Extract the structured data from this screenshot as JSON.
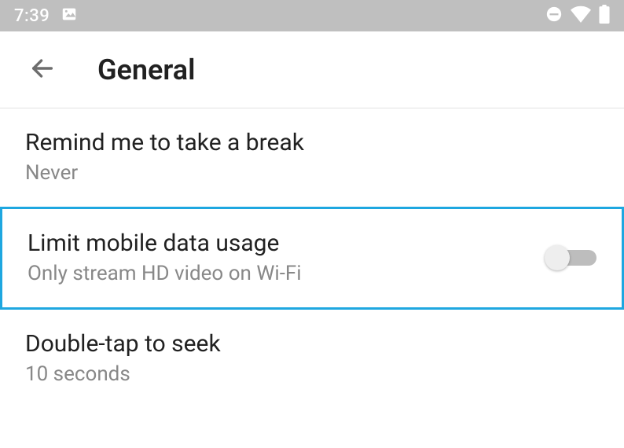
{
  "status": {
    "time": "7:39"
  },
  "header": {
    "title": "General"
  },
  "rows": [
    {
      "title": "Remind me to take a break",
      "subtitle": "Never"
    },
    {
      "title": "Limit mobile data usage",
      "subtitle": "Only stream HD video on Wi-Fi",
      "toggle": false,
      "highlight": true
    },
    {
      "title": "Double-tap to seek",
      "subtitle": "10 seconds"
    }
  ]
}
